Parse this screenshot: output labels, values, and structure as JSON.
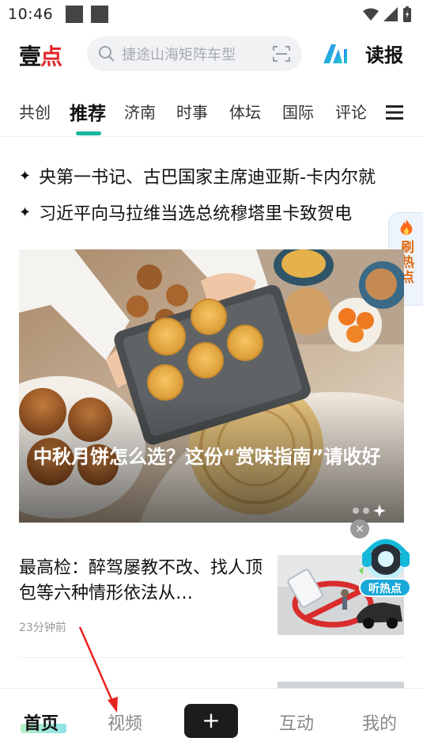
{
  "status_bar": {
    "time": "10:46"
  },
  "header": {
    "logo_text_left": "壹",
    "logo_text_right": "点",
    "search_placeholder": "捷途山海矩阵车型",
    "dubao_label": "读报"
  },
  "tabs": [
    {
      "label": "共创"
    },
    {
      "label": "推荐",
      "active": true
    },
    {
      "label": "济南"
    },
    {
      "label": "时事"
    },
    {
      "label": "体坛"
    },
    {
      "label": "国际"
    },
    {
      "label": "评论"
    }
  ],
  "headlines": [
    {
      "bullet": "✦",
      "text": "央第一书记、古巴国家主席迪亚斯-卡内尔就"
    },
    {
      "bullet": "✦",
      "text": "习近平向马拉维当选总统穆塔里卡致贺电"
    }
  ],
  "float_hot": {
    "label": "刷热点"
  },
  "hero": {
    "title": "中秋月饼怎么选？这份“赏味指南”请收好"
  },
  "listen_widget": {
    "label": "听热点",
    "close_glyph": "×"
  },
  "news_item": {
    "title": "最高检：醉驾屡教不改、找人顶包等六种情形依法从…",
    "time": "23分钟前"
  },
  "bottom_nav": {
    "items": [
      {
        "label": "首页",
        "active": true
      },
      {
        "label": "视频"
      },
      {
        "label": "互动"
      },
      {
        "label": "我的"
      }
    ],
    "plus_label": "+"
  },
  "colors": {
    "accent_teal": "#18b59f",
    "logo_red": "#e3262b",
    "annotation_red": "#e8231f"
  }
}
